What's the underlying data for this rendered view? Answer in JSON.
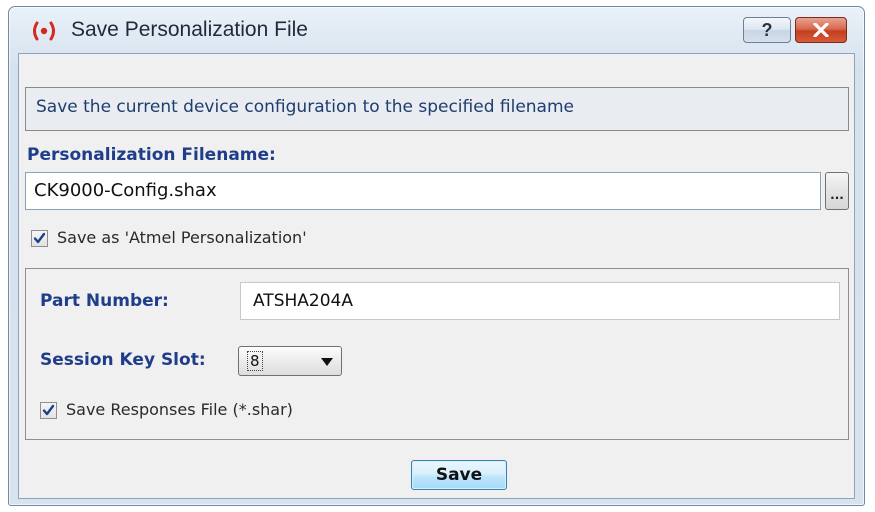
{
  "window": {
    "title": "Save Personalization File",
    "help_label": "?",
    "app_icon": "atmel-logo-icon",
    "close_icon": "close-icon"
  },
  "description": "Save the current device configuration to the specified filename",
  "filename": {
    "label": "Personalization Filename:",
    "value": "CK9000-Config.shax",
    "browse_label": "..."
  },
  "save_as_atmel": {
    "label": "Save as 'Atmel Personalization'",
    "checked": true
  },
  "part_number": {
    "label": "Part Number:",
    "value": "ATSHA204A"
  },
  "session_key_slot": {
    "label": "Session Key Slot:",
    "value": "8"
  },
  "save_responses": {
    "label": "Save Responses File (*.shar)",
    "checked": true
  },
  "save_button": {
    "label": "Save"
  },
  "colors": {
    "label_blue": "#1f3d8a",
    "description_text": "#1f3d6e",
    "close_red": "#c4401f"
  }
}
